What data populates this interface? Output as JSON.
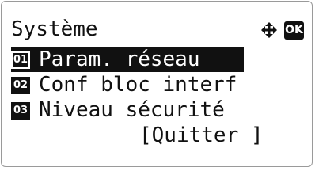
{
  "header": {
    "title": "Système",
    "navigation_icon": "up-down-left-right-arrows-icon",
    "ok_label": "OK"
  },
  "menu": {
    "items": [
      {
        "number": "01",
        "label": "Param. réseau",
        "selected": true
      },
      {
        "number": "02",
        "label": "Conf bloc interf",
        "selected": false
      },
      {
        "number": "03",
        "label": "Niveau sécurité",
        "selected": false
      }
    ]
  },
  "footer": {
    "quit_label": "[Quitter ]"
  },
  "colors": {
    "display_text": "#111111",
    "selection_background": "#111111",
    "background": "#ffffff"
  }
}
